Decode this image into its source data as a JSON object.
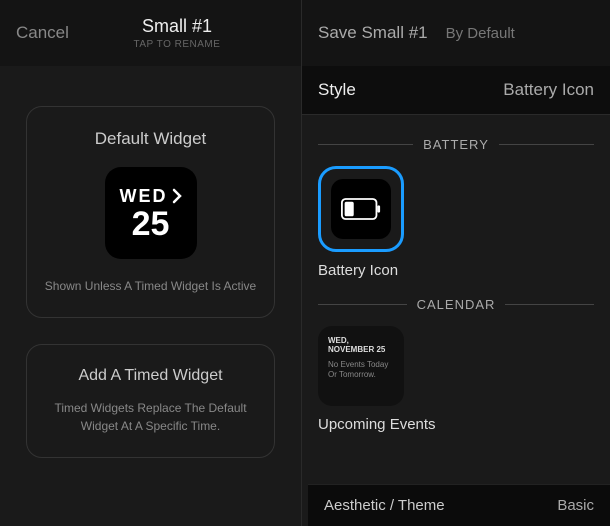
{
  "header": {
    "cancel": "Cancel",
    "title": "Small #1",
    "subtitle": "TAP TO RENAME",
    "save": "Save Small #1",
    "by": "By Default"
  },
  "left": {
    "default_card": {
      "title": "Default Widget",
      "day": "WED",
      "date": "25",
      "desc": "Shown Unless A Timed Widget Is Active"
    },
    "timed_card": {
      "title": "Add A Timed Widget",
      "desc": "Timed Widgets Replace The Default Widget At A Specific Time."
    }
  },
  "right": {
    "tabs": {
      "style": "Style",
      "value": "Battery Icon"
    },
    "sections": {
      "battery": {
        "label": "BATTERY",
        "item_label": "Battery Icon"
      },
      "calendar": {
        "label": "CALENDAR",
        "date": "WED, NOVEMBER 25",
        "note": "No Events Today Or Tomorrow.",
        "item_label": "Upcoming Events"
      }
    },
    "bottom": {
      "left": "Aesthetic / Theme",
      "right": "Basic"
    }
  }
}
